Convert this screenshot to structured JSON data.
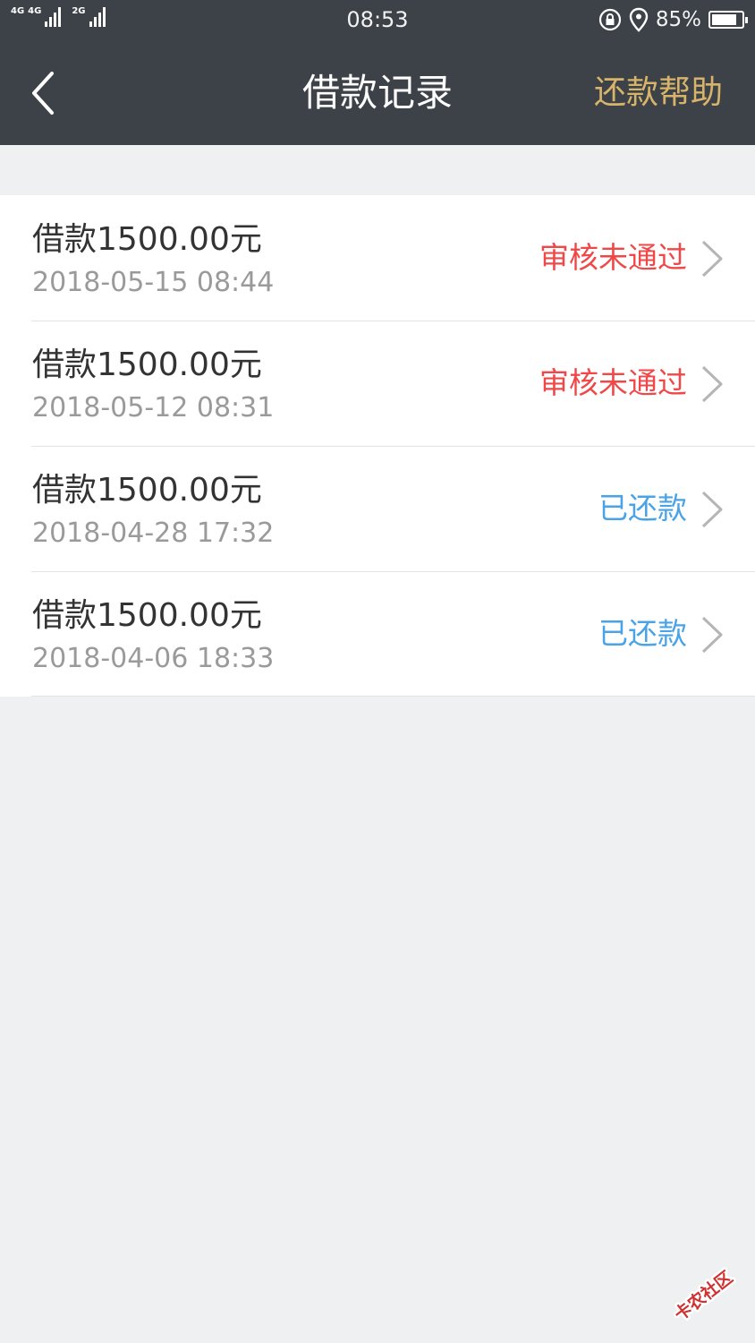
{
  "status_bar": {
    "net1": "4G",
    "net2": "4G",
    "net3": "2G",
    "time": "08:53",
    "battery_pct": "85%",
    "battery_level": 0.85
  },
  "nav": {
    "title": "借款记录",
    "help_label": "还款帮助"
  },
  "records": [
    {
      "amount": "借款1500.00元",
      "date": "2018-05-15 08:44",
      "status": "审核未通过",
      "status_color": "#f04848"
    },
    {
      "amount": "借款1500.00元",
      "date": "2018-05-12 08:31",
      "status": "审核未通过",
      "status_color": "#f04848"
    },
    {
      "amount": "借款1500.00元",
      "date": "2018-04-28 17:32",
      "status": "已还款",
      "status_color": "#4aa3e6"
    },
    {
      "amount": "借款1500.00元",
      "date": "2018-04-06 18:33",
      "status": "已还款",
      "status_color": "#4aa3e6"
    }
  ],
  "watermark": {
    "text": "卡农社区"
  },
  "colors": {
    "header_bg": "#3d4248",
    "accent_gold": "#d8b46a",
    "rejected": "#f04848",
    "repaid": "#4aa3e6",
    "page_bg": "#eef0f2"
  },
  "icons": [
    "signal-icon",
    "lock-rotation-icon",
    "location-icon",
    "battery-icon",
    "back-arrow-icon",
    "chevron-right-icon"
  ]
}
